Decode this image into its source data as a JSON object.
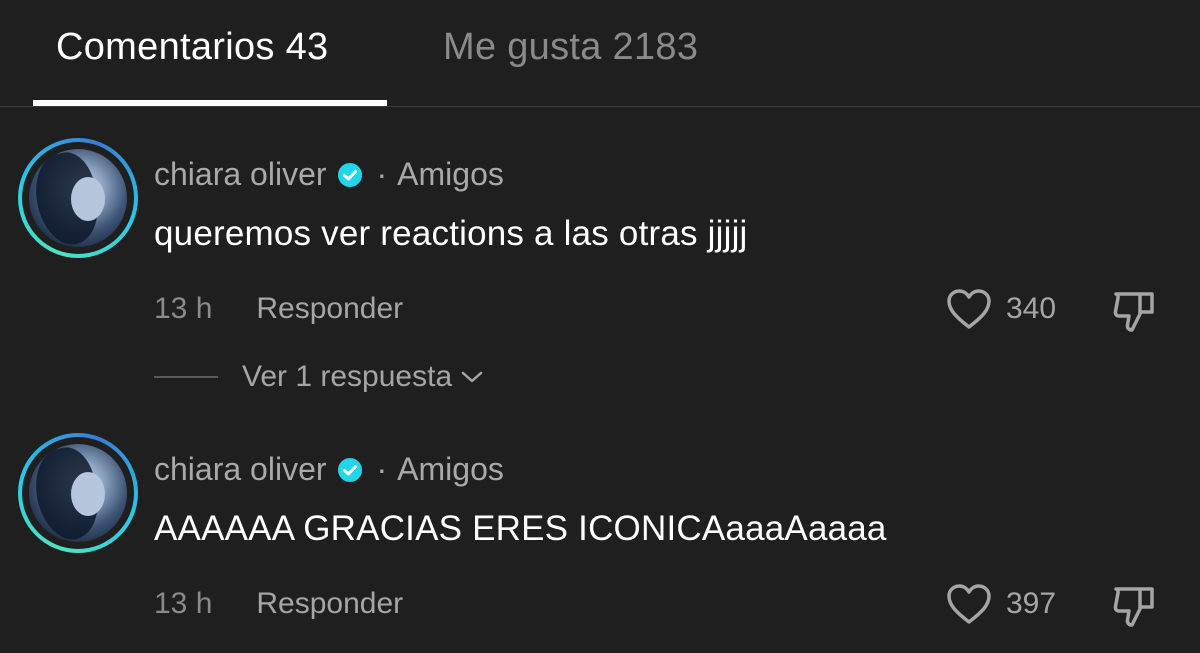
{
  "tabs": {
    "comments_label": "Comentarios 43",
    "likes_label": "Me gusta 2183"
  },
  "comments": [
    {
      "author": "chiara oliver",
      "relation": "Amigos",
      "text": "queremos ver reactions a las otras jjjjj",
      "time": "13 h",
      "reply_label": "Responder",
      "likes": "340"
    },
    {
      "author": "chiara oliver",
      "relation": "Amigos",
      "text": "AAAAAA GRACIAS ERES ICONICAaaaAaaaa",
      "time": "13 h",
      "reply_label": "Responder",
      "likes": "397"
    }
  ],
  "view_replies": {
    "label": "Ver 1 respuesta"
  },
  "separator": "·",
  "colors": {
    "background": "#1f1f1f",
    "verified": "#20d5ec",
    "avatar_ring": "#27c9e8"
  },
  "icons": [
    "verified-badge-icon",
    "heart-icon",
    "dislike-icon",
    "chevron-down-icon"
  ]
}
